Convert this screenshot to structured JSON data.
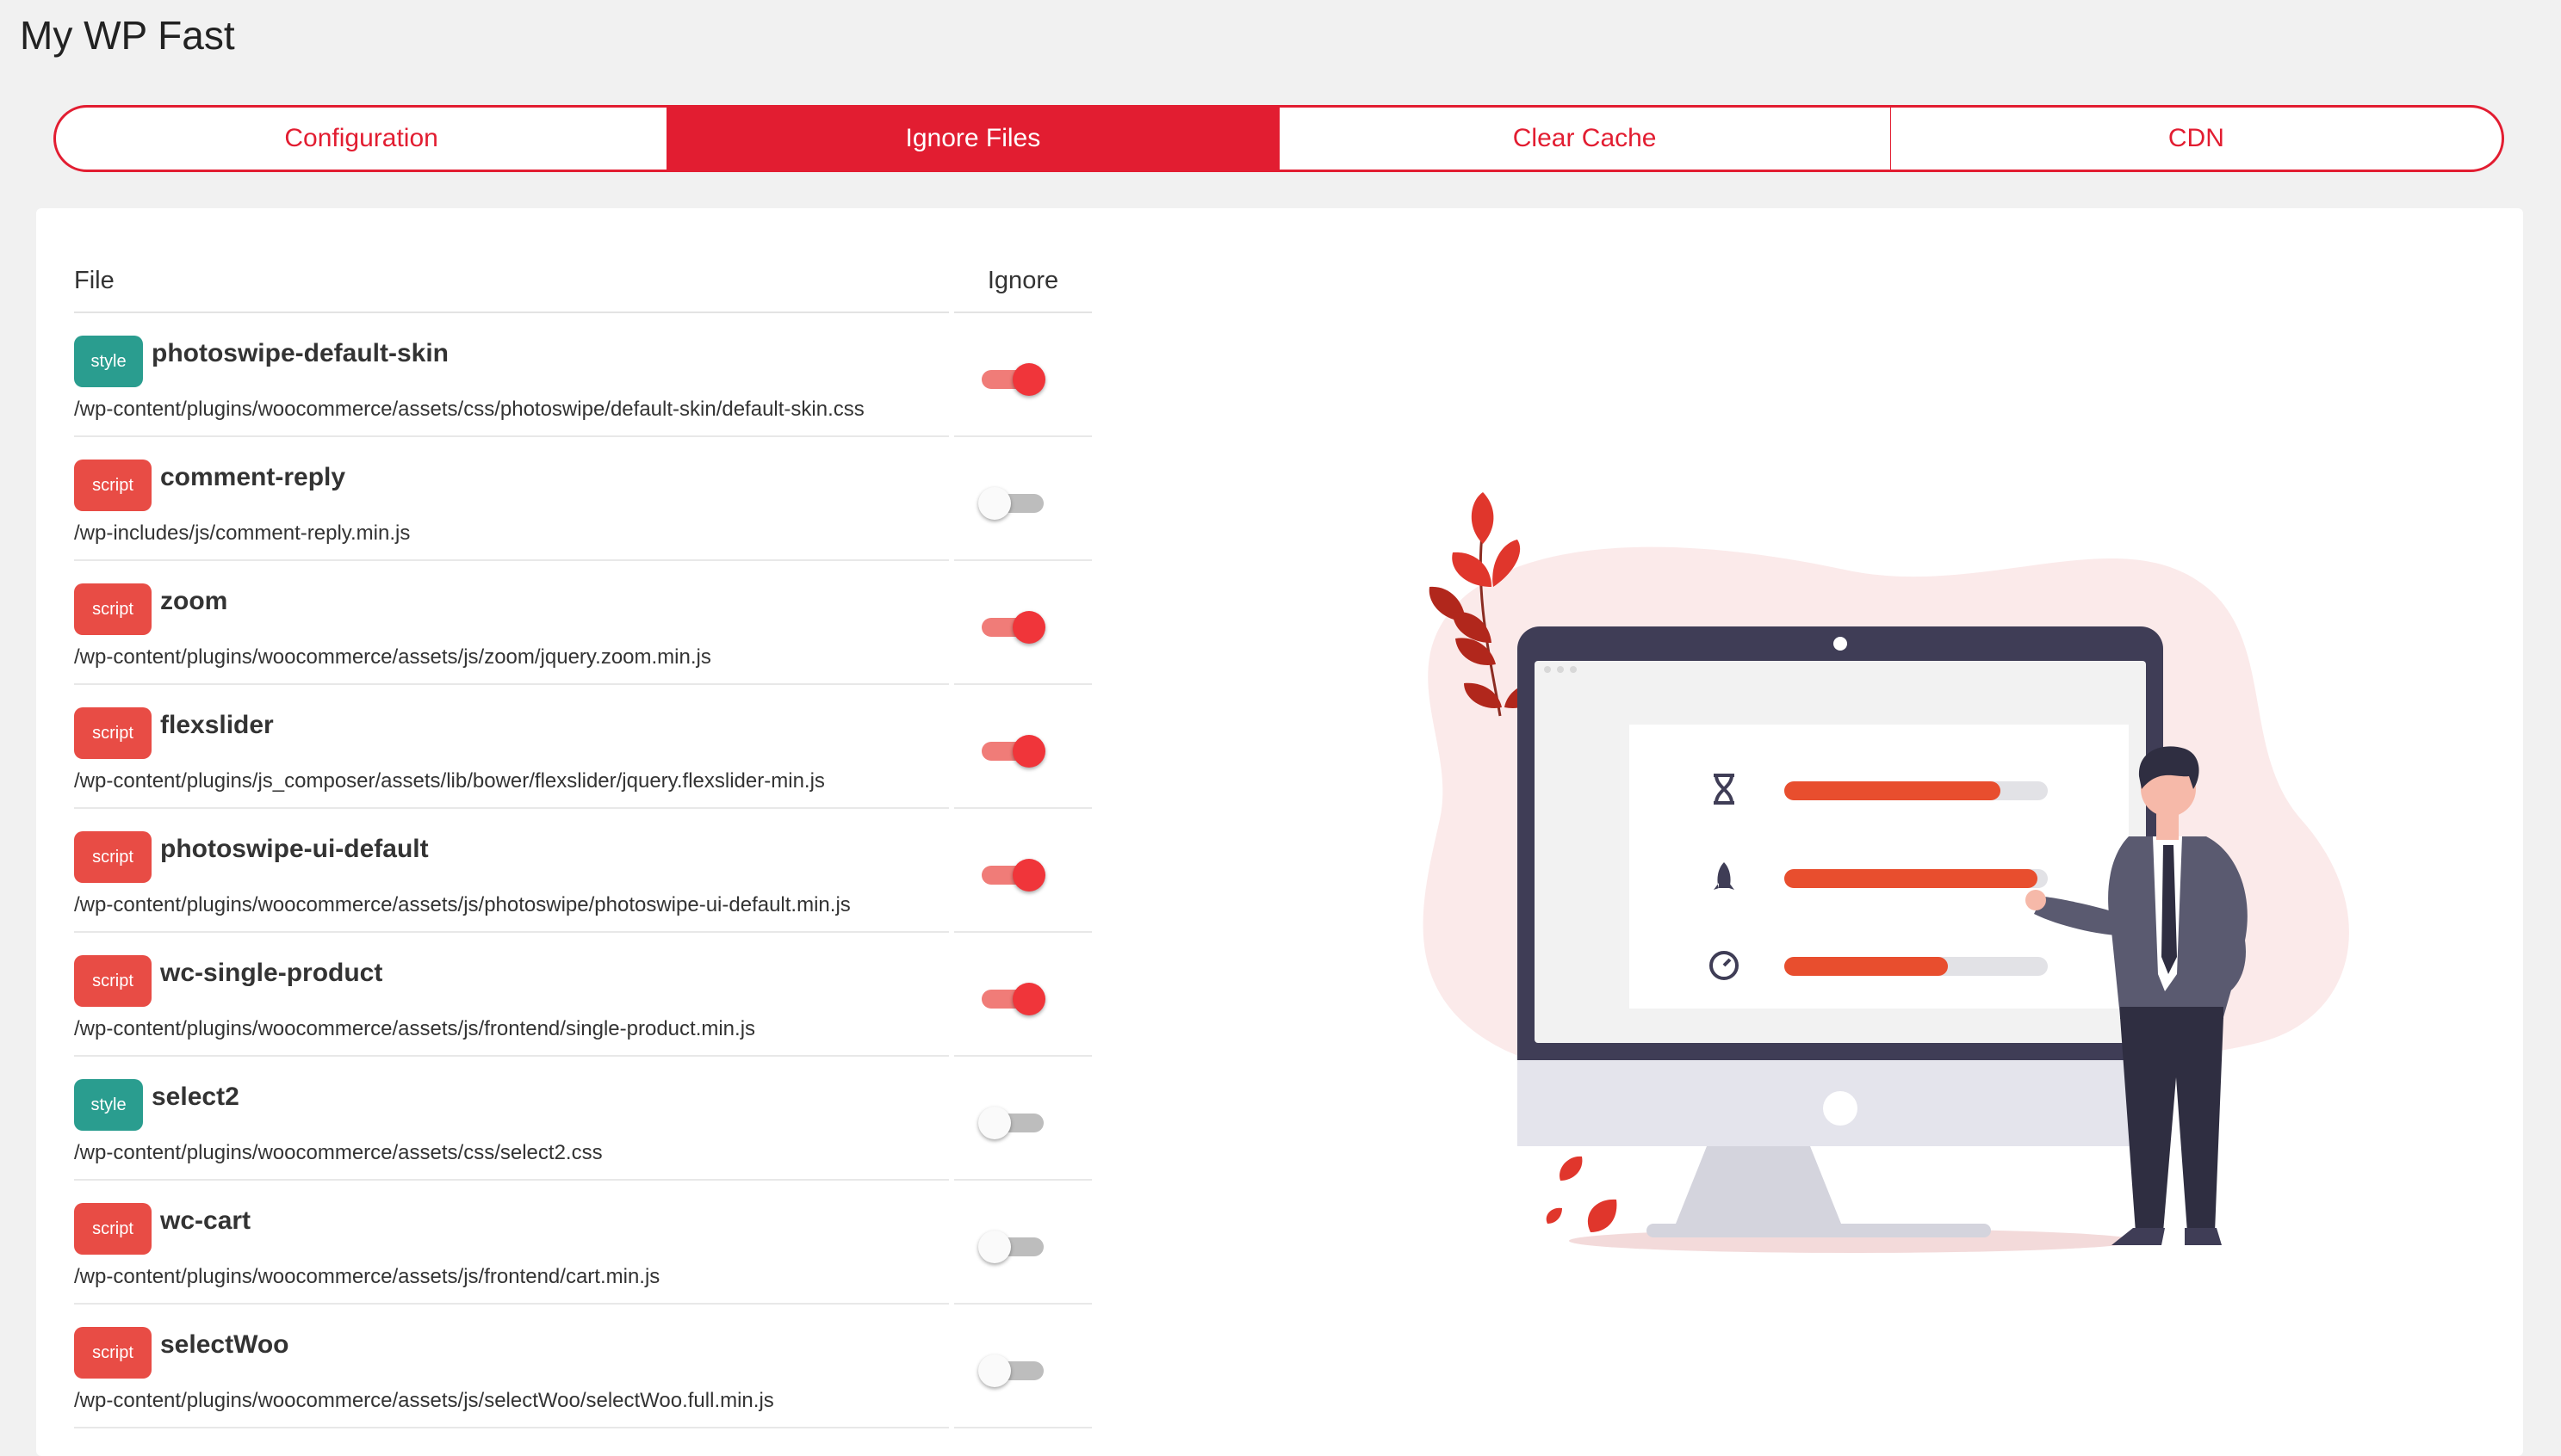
{
  "app": {
    "title": "My WP Fast"
  },
  "tabs": [
    {
      "label": "Configuration",
      "active": false
    },
    {
      "label": "Ignore Files",
      "active": true
    },
    {
      "label": "Clear Cache",
      "active": false
    },
    {
      "label": "CDN",
      "active": false
    }
  ],
  "table": {
    "headers": {
      "file": "File",
      "ignore": "Ignore"
    },
    "rows": [
      {
        "type": "style",
        "name": "photoswipe-default-skin",
        "path": "/wp-content/plugins/woocommerce/assets/css/photoswipe/default-skin/default-skin.css",
        "ignored": true
      },
      {
        "type": "script",
        "name": "comment-reply",
        "path": "/wp-includes/js/comment-reply.min.js",
        "ignored": false
      },
      {
        "type": "script",
        "name": "zoom",
        "path": "/wp-content/plugins/woocommerce/assets/js/zoom/jquery.zoom.min.js",
        "ignored": true
      },
      {
        "type": "script",
        "name": "flexslider",
        "path": "/wp-content/plugins/js_composer/assets/lib/bower/flexslider/jquery.flexslider-min.js",
        "ignored": true
      },
      {
        "type": "script",
        "name": "photoswipe-ui-default",
        "path": "/wp-content/plugins/woocommerce/assets/js/photoswipe/photoswipe-ui-default.min.js",
        "ignored": true
      },
      {
        "type": "script",
        "name": "wc-single-product",
        "path": "/wp-content/plugins/woocommerce/assets/js/frontend/single-product.min.js",
        "ignored": true
      },
      {
        "type": "style",
        "name": "select2",
        "path": "/wp-content/plugins/woocommerce/assets/css/select2.css",
        "ignored": false
      },
      {
        "type": "script",
        "name": "wc-cart",
        "path": "/wp-content/plugins/woocommerce/assets/js/frontend/cart.min.js",
        "ignored": false
      },
      {
        "type": "script",
        "name": "selectWoo",
        "path": "/wp-content/plugins/woocommerce/assets/js/selectWoo/selectWoo.full.min.js",
        "ignored": false
      }
    ]
  },
  "illustration": {
    "progress": [
      {
        "icon": "hourglass-icon",
        "fraction": 0.82
      },
      {
        "icon": "rocket-icon",
        "fraction": 0.96
      },
      {
        "icon": "speedometer-icon",
        "fraction": 0.62
      }
    ],
    "colors": {
      "accent": "#e21d31",
      "bar": "#e84e2e",
      "blob": "#fbeaea",
      "monitor": "#3f3d56"
    }
  }
}
